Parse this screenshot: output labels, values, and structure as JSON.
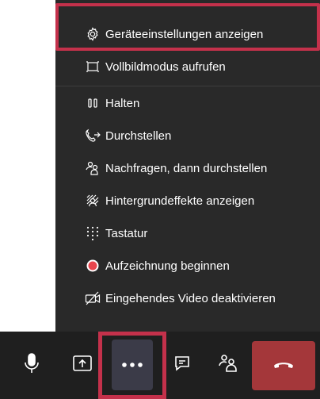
{
  "menu": {
    "items": [
      {
        "label": "Geräteeinstellungen anzeigen",
        "icon": "gear-icon"
      },
      {
        "label": "Vollbildmodus aufrufen",
        "icon": "fullscreen-icon"
      },
      {
        "label": "Halten",
        "icon": "pause-icon"
      },
      {
        "label": "Durchstellen",
        "icon": "transfer-call-icon"
      },
      {
        "label": "Nachfragen, dann durchstellen",
        "icon": "consult-transfer-icon"
      },
      {
        "label": "Hintergrundeffekte anzeigen",
        "icon": "background-effects-icon"
      },
      {
        "label": "Tastatur",
        "icon": "dialpad-icon"
      },
      {
        "label": "Aufzeichnung beginnen",
        "icon": "record-icon"
      },
      {
        "label": "Eingehendes Video deaktivieren",
        "icon": "video-off-icon"
      }
    ]
  },
  "toolbar": {
    "buttons": [
      "microphone-icon",
      "share-screen-icon",
      "more-options-icon",
      "chat-icon",
      "participants-icon",
      "hang-up-icon"
    ]
  },
  "colors": {
    "menu_bg": "#292929",
    "toolbar_bg": "#1f1f1f",
    "highlight": "#c4314b",
    "record": "#e8454d",
    "hangup": "#a4373a",
    "more_bg": "#3b3b48"
  }
}
